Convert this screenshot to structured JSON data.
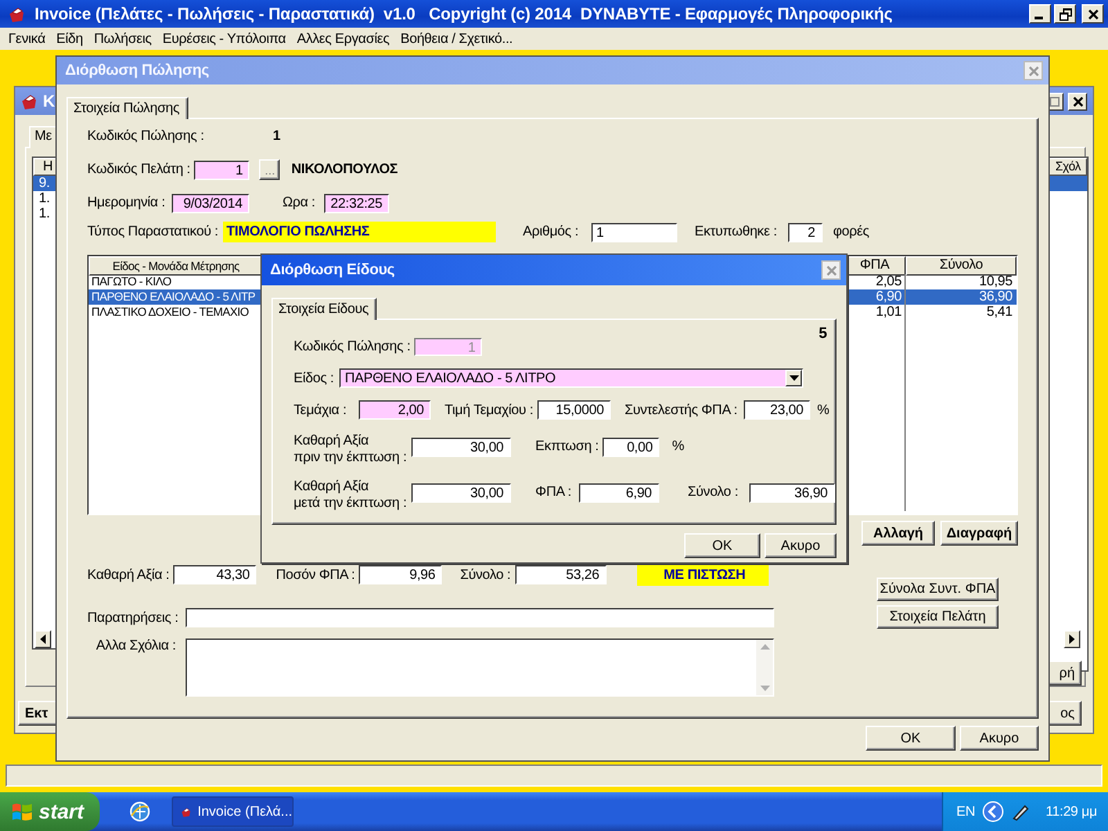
{
  "app": {
    "title": "Invoice (Πελάτες - Πωλήσεις - Παραστατικά)  v1.0   Copyright (c) 2014  DYNABYTE - Εφαρμογές Πληροφορικής",
    "menu": [
      "Γενικά",
      "Είδη",
      "Πωλήσεις",
      "Ευρέσεις - Υπόλοιπα",
      "Αλλες Εργασίες",
      "Βοήθεια / Σχετικό..."
    ]
  },
  "background_window": {
    "title": "Κ",
    "tab": "Με",
    "list_column_1": "Η",
    "list_rows": [
      {
        "text": "9.",
        "selected": true
      },
      {
        "text": "1.",
        "selected": false
      },
      {
        "text": "1.",
        "selected": false
      }
    ],
    "list_column_2": "Σχόλ",
    "button_1": "Εκτ",
    "button_2": "ρή",
    "button_3": "ος"
  },
  "sale_dialog": {
    "title": "Διόρθωση Πώλησης",
    "tabs": [
      {
        "label": "Στοιχεία Πώλησης",
        "selected": true
      }
    ],
    "sale_code": {
      "label": "Κωδικός Πώλησης :",
      "value": "1"
    },
    "customer": {
      "label": "Κωδικός Πελάτη :",
      "value": "1",
      "browse_button": "...",
      "name": "ΝΙΚΟΛΟΠΟΥΛΟΣ"
    },
    "date": {
      "label": "Ημερομηνία :",
      "value": "9/03/2014"
    },
    "time": {
      "label": "Ωρα :",
      "value": "22:32:25"
    },
    "document_type": {
      "label": "Τύπος Παραστατικού :",
      "value": "ΤΙΜΟΛΟΓΙΟ ΠΩΛΗΣΗΣ"
    },
    "number": {
      "label": "Αριθμός :",
      "value": "1"
    },
    "printed": {
      "label": "Εκτυπωθηκε :",
      "value": "2",
      "suffix": "φορές"
    },
    "items_table": {
      "columns": [
        "Είδος - Μονάδα Μέτρησης",
        "ΦΠΑ",
        "Σύνολο"
      ],
      "rows": [
        {
          "cells": [
            "ΠΑΓΩΤΟ - ΚΙΛΟ",
            "2,05",
            "10,95"
          ],
          "selected": false
        },
        {
          "cells": [
            "ΠΑΡΘΕΝΟ ΕΛΑΙΟΛΑΔΟ - 5 ΛΙΤΡ",
            "6,90",
            "36,90"
          ],
          "selected": true
        },
        {
          "cells": [
            "ΠΛΑΣΤΙΚΟ ΔΟΧΕΙΟ - ΤΕΜΑΧΙΟ",
            "1,01",
            "5,41"
          ],
          "selected": false
        }
      ]
    },
    "item_buttons": [
      "Αλλαγή",
      "Διαγραφή"
    ],
    "totals": [
      {
        "label": "Καθαρή Αξία :",
        "value": "43,30"
      },
      {
        "label": "Ποσόν ΦΠΑ :",
        "value": "9,96"
      },
      {
        "label": "Σύνολο :",
        "value": "53,26"
      }
    ],
    "payment": "ΜΕ ΠΙΣΤΩΣΗ",
    "side_buttons": [
      "Σύνολα Συντ. ΦΠΑ",
      "Στοιχεία Πελάτη"
    ],
    "notes": {
      "label": "Παρατηρήσεις :"
    },
    "comments": {
      "label": "Αλλα Σχόλια :"
    },
    "buttons": [
      "OK",
      "Ακυρο"
    ]
  },
  "item_dialog": {
    "title": "Διόρθωση Είδους",
    "tabs": [
      {
        "label": "Στοιχεία Είδους",
        "selected": true
      }
    ],
    "counter": "5",
    "sale_code": {
      "label": "Κωδικός Πώλησης :",
      "value": "1",
      "disabled": true
    },
    "item": {
      "label": "Είδος :",
      "value": "ΠΑΡΘΕΝΟ ΕΛΑΙΟΛΑΔΟ - 5 ΛΙΤΡΟ"
    },
    "quantity": {
      "label": "Τεμάχια :",
      "value": "2,00"
    },
    "unit_price": {
      "label": "Τιμή Τεμαχίου :",
      "value": "15,0000"
    },
    "vat_rate": {
      "label": "Συντελεστής ΦΠΑ :",
      "value": "23,00",
      "unit": "%"
    },
    "net_before_discount": {
      "label": "Καθαρή Αξία\nπριν την έκπτωση :",
      "value": "30,00"
    },
    "discount": {
      "label": "Εκπτωση :",
      "value": "0,00",
      "unit": "%"
    },
    "net_after_discount": {
      "label": "Καθαρή Αξία\nμετά την έκπτωση :",
      "value": "30,00"
    },
    "vat": {
      "label": "ΦΠΑ :",
      "value": "6,90"
    },
    "total": {
      "label": "Σύνολο :",
      "value": "36,90"
    },
    "buttons": [
      "OK",
      "Ακυρο"
    ]
  },
  "taskbar": {
    "start": "start",
    "task": "Invoice (Πελά...",
    "language": "EN",
    "clock": "11:29 μμ"
  }
}
